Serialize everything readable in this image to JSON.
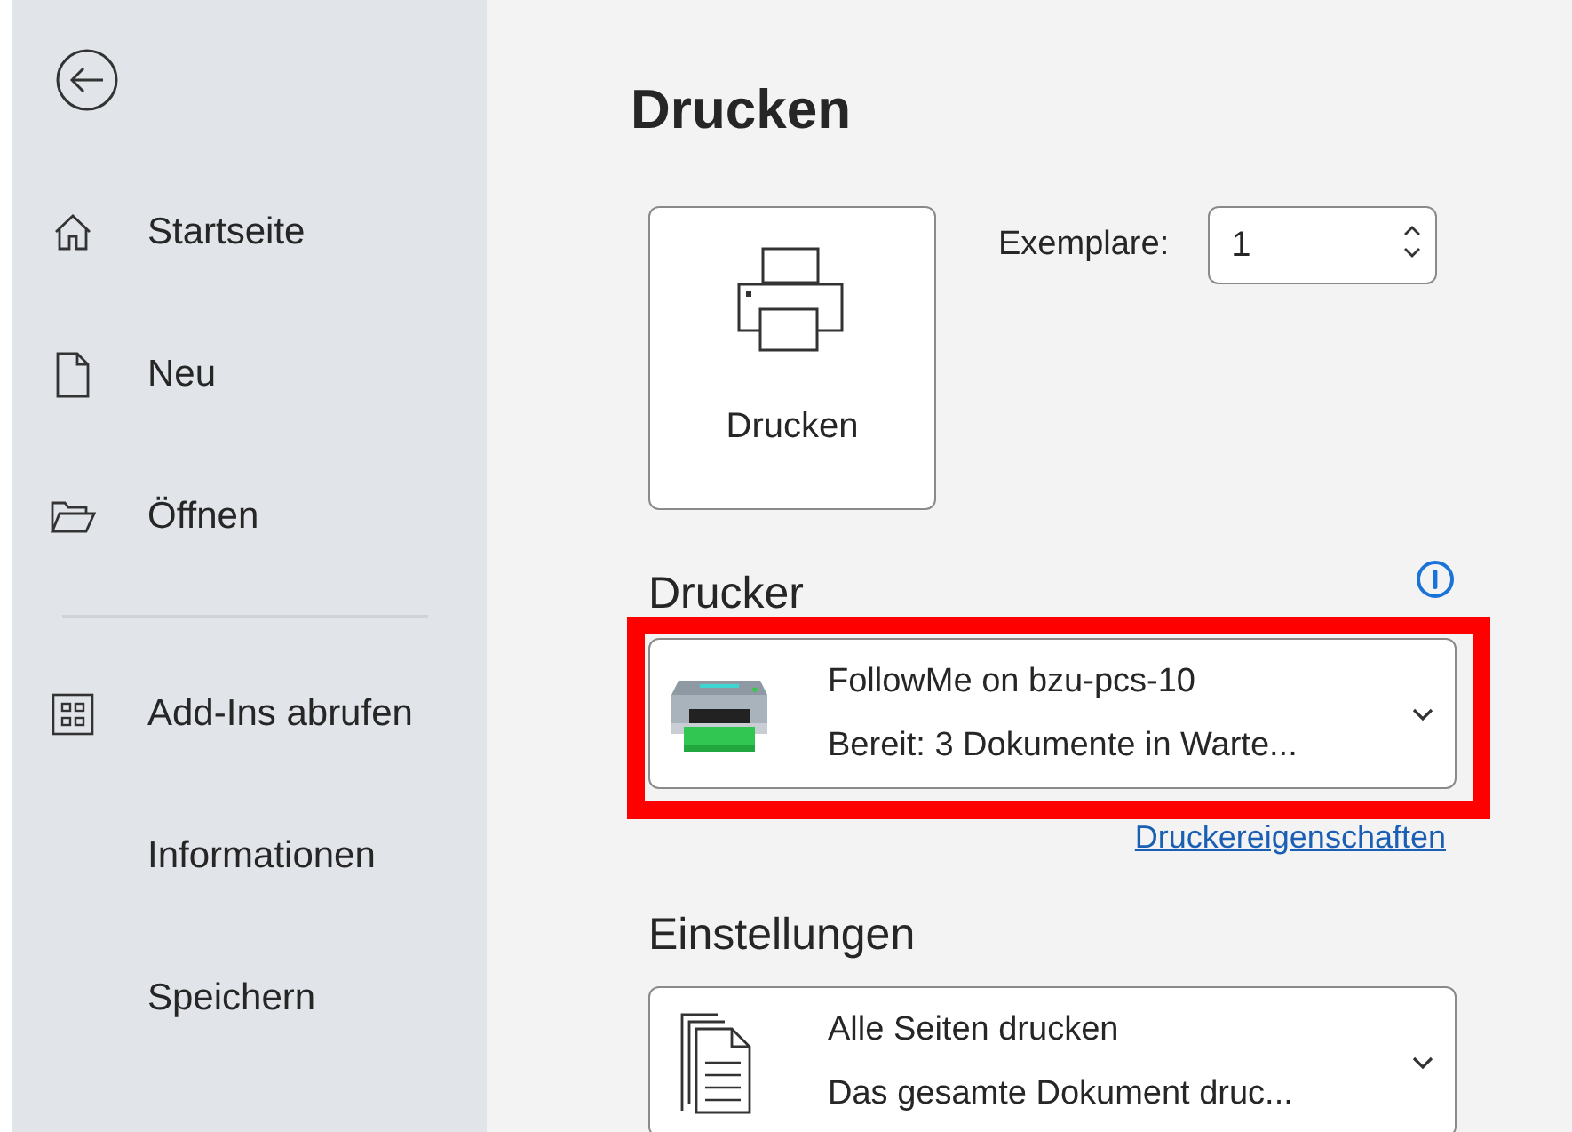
{
  "sidebar": {
    "back_button": {
      "kind": "back"
    },
    "items": [
      {
        "label": "Startseite",
        "kind": "home"
      },
      {
        "label": "Neu",
        "kind": "page"
      },
      {
        "label": "Öffnen",
        "kind": "folder"
      },
      {
        "kind": "divider"
      },
      {
        "label": "Add-Ins abrufen",
        "kind": "grid"
      },
      {
        "label": "Informationen",
        "kind": "plain"
      },
      {
        "label": "Speichern",
        "kind": "plain"
      }
    ]
  },
  "main": {
    "title": "Drucken",
    "print_button": {
      "label": "Drucken"
    },
    "copies": {
      "label": "Exemplare:",
      "value": "1"
    },
    "printer": {
      "heading": "Drucker",
      "name": "FollowMe on bzu-pcs-10",
      "status": "Bereit: 3 Dokumente in Warte...",
      "highlighted": true,
      "link": "Druckereigenschaften"
    },
    "settings": {
      "heading": "Einstellungen",
      "option": "Alle Seiten drucken",
      "description": "Das gesamte Dokument druc..."
    }
  }
}
